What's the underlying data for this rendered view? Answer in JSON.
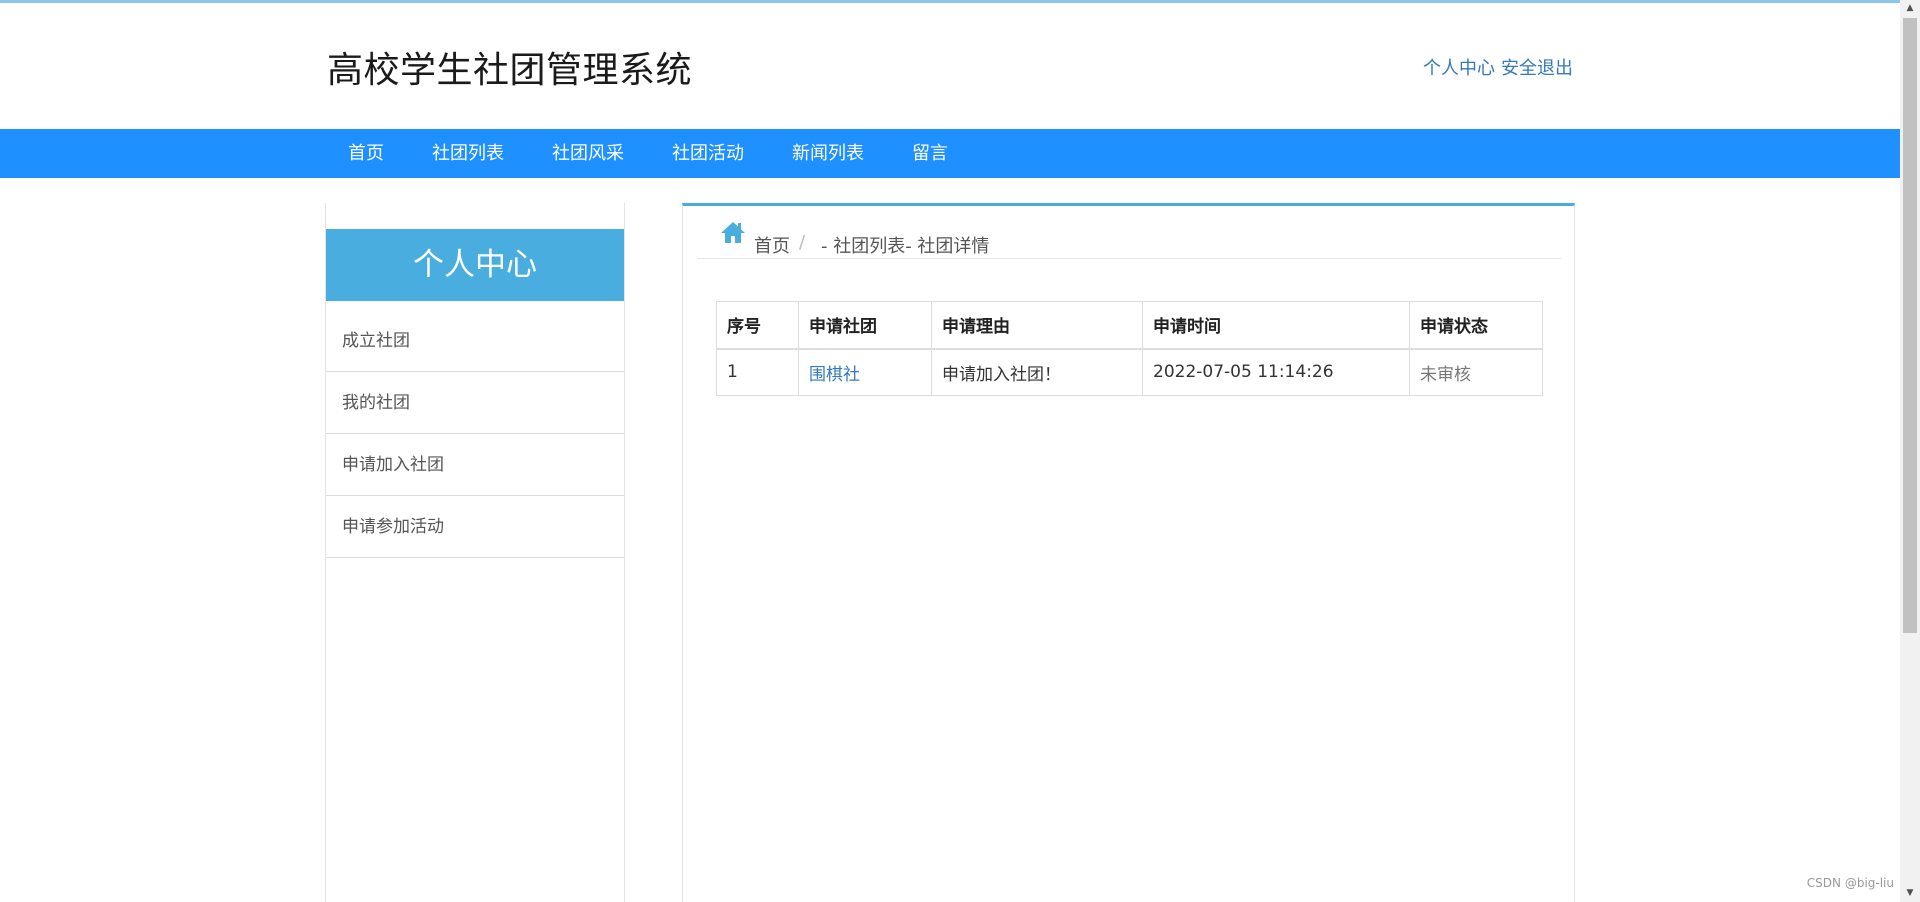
{
  "header": {
    "title": "高校学生社团管理系统",
    "links": [
      "个人中心",
      "安全退出"
    ]
  },
  "nav": {
    "items": [
      "首页",
      "社团列表",
      "社团风采",
      "社团活动",
      "新闻列表",
      "留言"
    ]
  },
  "sidebar": {
    "title": "个人中心",
    "items": [
      "成立社团",
      "我的社团",
      "申请加入社团",
      "申请参加活动"
    ]
  },
  "breadcrumb": {
    "home": "首页",
    "separator": "/",
    "rest": "- 社团列表- 社团详情"
  },
  "table": {
    "headers": [
      "序号",
      "申请社团",
      "申请理由",
      "申请时间",
      "申请状态"
    ],
    "rows": [
      {
        "index": "1",
        "club": "围棋社",
        "reason": "申请加入社团！",
        "time": "2022-07-05 11:14:26",
        "status": "未审核"
      }
    ]
  },
  "watermark": "CSDN @big-liu",
  "colors": {
    "nav_bg": "#1e90ff",
    "accent": "#4aaddf",
    "link": "#337ab7"
  }
}
